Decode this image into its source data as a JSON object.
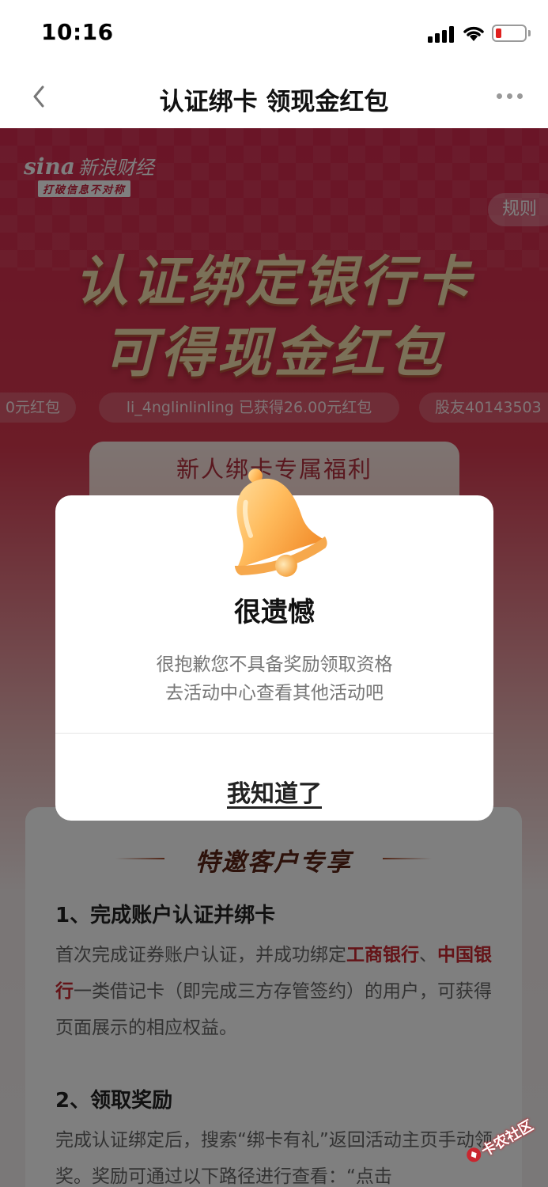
{
  "status_bar": {
    "time": "10:16"
  },
  "nav": {
    "title": "认证绑卡 领现金红包"
  },
  "brand": {
    "logo_latin": "sina",
    "logo_cn": "新浪财经",
    "slogan": "打破信息不对称"
  },
  "banner": {
    "rules_label": "规则",
    "headline_1": "认证绑定银行卡",
    "headline_2": "可得现金红包"
  },
  "ticker": [
    "0元红包",
    "li_4nglinlinling 已获得26.00元红包",
    "股友40143503"
  ],
  "benefit": {
    "title": "新人绑卡专属福利"
  },
  "info": {
    "title": "特邀客户专享",
    "section1_heading": "1、完成账户认证并绑卡",
    "section1_text_a": "首次完成证券账户认证，并成功绑定",
    "section1_bank1": "工商银行",
    "section1_sep": "、",
    "section1_bank2": "中国银行",
    "section1_text_b": "一类借记卡（即完成三方存管签约）的",
    "section1_text_c": "用户，可获得页面展示的相应权益。",
    "section2_heading": "2、领取奖励",
    "section2_text_a": "完成认证绑定后，搜索“绑卡有礼”返回活动主页",
    "section2_text_b": "手动领奖。奖励可通过以下路径进行查看：“点击"
  },
  "modal": {
    "title": "很遗憾",
    "message_line1": "很抱歉您不具备奖励领取资格",
    "message_line2": "去活动中心查看其他活动吧",
    "confirm_label": "我知道了"
  },
  "watermark": {
    "text": "卡农社区"
  },
  "colors": {
    "accent_red": "#c9262f",
    "banner_red": "#d42a4f",
    "battery_low": "#e0201e"
  }
}
